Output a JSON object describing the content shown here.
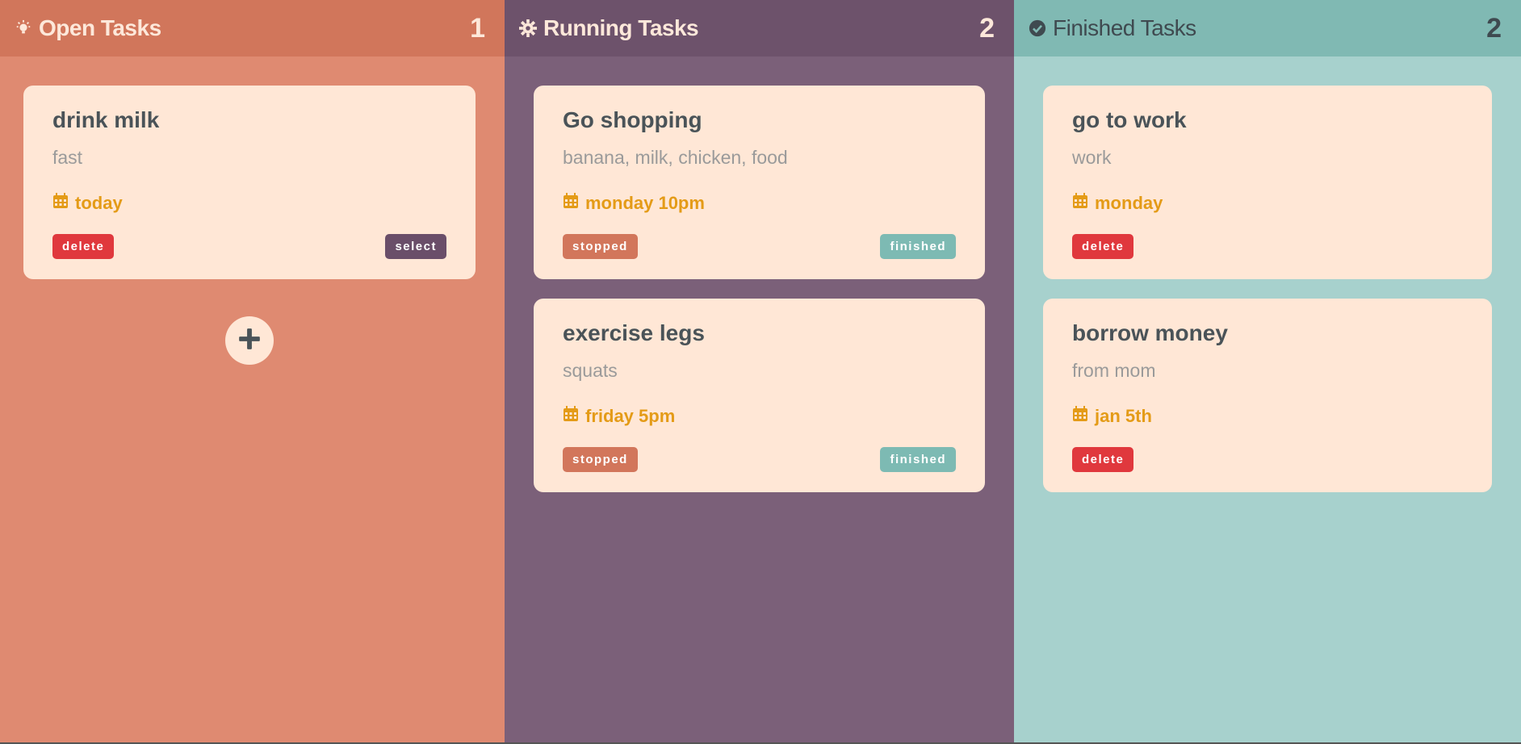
{
  "columns": {
    "open": {
      "title": "Open Tasks",
      "count": "1",
      "icon": "lightbulb-icon",
      "cards": [
        {
          "title": "drink milk",
          "desc": "fast",
          "date": "today",
          "left_btn": "delete",
          "right_btn": "select"
        }
      ],
      "add_icon": "plus-icon"
    },
    "running": {
      "title": "Running Tasks",
      "count": "2",
      "icon": "gear-icon",
      "cards": [
        {
          "title": "Go shopping",
          "desc": "banana, milk, chicken, food",
          "date": "monday 10pm",
          "left_btn": "stopped",
          "right_btn": "finished"
        },
        {
          "title": "exercise legs",
          "desc": "squats",
          "date": "friday 5pm",
          "left_btn": "stopped",
          "right_btn": "finished"
        }
      ]
    },
    "finished": {
      "title": "Finished Tasks",
      "count": "2",
      "icon": "check-circle-icon",
      "cards": [
        {
          "title": "go to work",
          "desc": "work",
          "date": "monday",
          "left_btn": "delete"
        },
        {
          "title": "borrow money",
          "desc": "from mom",
          "date": "jan 5th",
          "left_btn": "delete"
        }
      ]
    }
  },
  "colors": {
    "open_bg": "#df8a71",
    "running_bg": "#7b6079",
    "finished_bg": "#a7d1cd",
    "card_bg": "#ffe7d6",
    "date_color": "#e49b17",
    "delete_btn": "#e0383d",
    "select_btn": "#6a4e69",
    "stopped_btn": "#d2765b",
    "finished_btn": "#7dbab3"
  }
}
